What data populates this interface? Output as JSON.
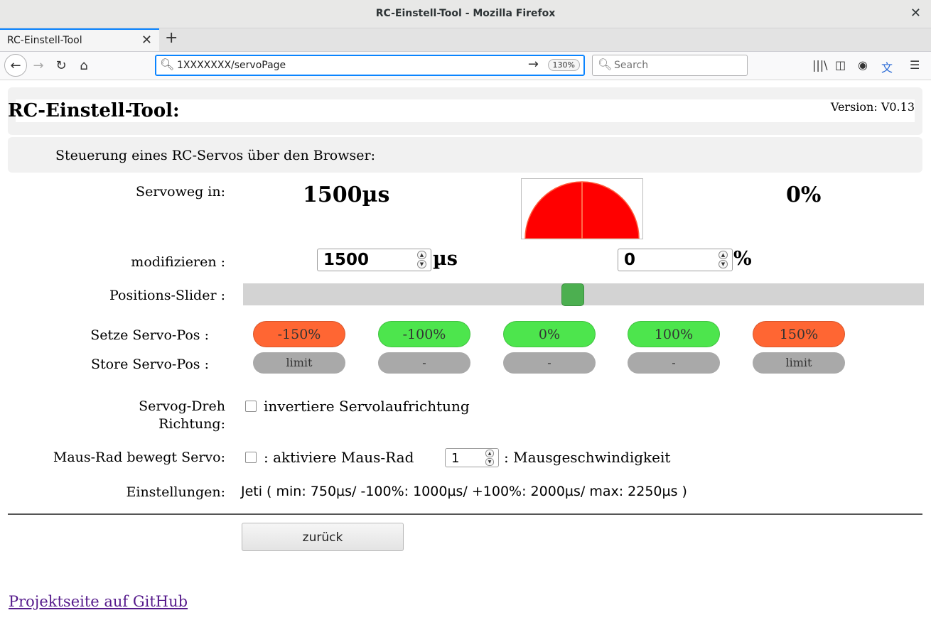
{
  "window": {
    "title": "RC-Einstell-Tool - Mozilla Firefox",
    "close_glyph": "✕"
  },
  "tab": {
    "label": "RC-Einstell-Tool",
    "close_glyph": "✕"
  },
  "newtab_glyph": "+",
  "nav": {
    "back_glyph": "←",
    "forward_glyph": "→",
    "reload_glyph": "↻",
    "home_glyph": "⌂",
    "url": "1XXXXXXX/servoPage",
    "go_glyph": "→",
    "zoom": "130%",
    "search_placeholder": "Search",
    "library_glyph": "|||\\",
    "sidebar_glyph": "◫",
    "account_glyph": "◉",
    "translate_glyph": "文",
    "menu_glyph": "☰"
  },
  "header": {
    "title": "RC-Einstell-Tool:",
    "version": "Version: V0.13",
    "subtitle": "Steuerung eines RC-Servos über den Browser:"
  },
  "servo": {
    "label_servoweg": "Servoweg in:",
    "pulse_value": "1500µs",
    "percent_value": "0%",
    "label_modify": "modifizieren :",
    "pulse_input": "1500",
    "pulse_unit": "µs",
    "percent_input": "0",
    "percent_unit": "%",
    "label_slider": "Positions-Slider :",
    "slider_level": 0.5,
    "gauge_color": "#ff0000",
    "label_setze": "Setze Servo-Pos :",
    "label_store": "Store Servo-Pos :",
    "position_buttons": [
      {
        "label": "-150%",
        "color": "#ff6633"
      },
      {
        "label": "-100%",
        "color": "#4de54d"
      },
      {
        "label": "0%",
        "color": "#4de54d"
      },
      {
        "label": "100%",
        "color": "#4de54d"
      },
      {
        "label": "150%",
        "color": "#ff6633"
      }
    ],
    "store_buttons": [
      "limit",
      "-",
      "-",
      "-",
      "limit"
    ],
    "label_dreh_line1": "Servog-Dreh",
    "label_dreh_line2": "Richtung:",
    "invert_label": "invertiere Servolaufrichtung",
    "label_mausrad": "Maus-Rad bewegt Servo:",
    "mausrad_label": ": aktiviere Maus-Rad",
    "mouse_speed": "1",
    "mouse_speed_label": ": Mausgeschwindigkeit",
    "label_settings": "Einstellungen:",
    "settings_value": "Jeti ( min: 750µs/ -100%: 1000µs/ +100%: 2000µs/ max: 2250µs )",
    "back_button": "zurück",
    "github_link": "Projektseite auf GitHub"
  }
}
